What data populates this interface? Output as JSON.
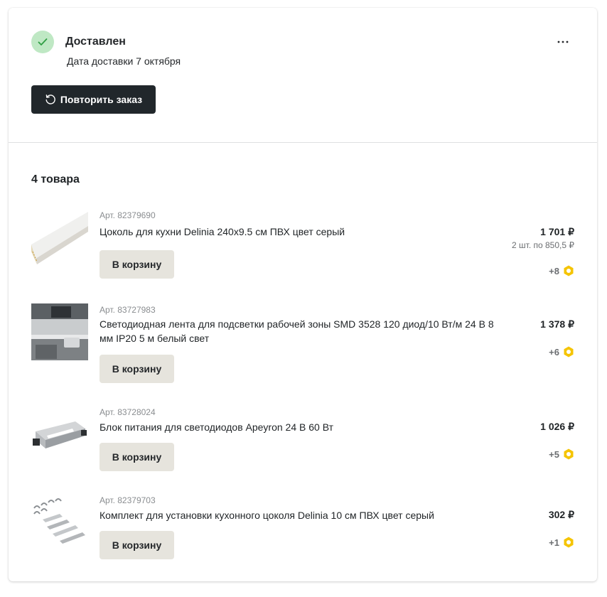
{
  "order": {
    "status_title": "Доставлен",
    "delivery_date": "Дата доставки 7 октября",
    "repeat_button": "Повторить заказ",
    "more_icon": "more-horizontal-icon",
    "items_count_title": "4 товара"
  },
  "colors": {
    "status_bg": "#bfe8c4",
    "status_check": "#2f9e44",
    "primary_button": "#21272b",
    "cart_button": "#e6e4dd",
    "bonus_badge": "#f5c400"
  },
  "items": [
    {
      "article": "Арт. 82379690",
      "name": "Цоколь для кухни Delinia 240x9.5 см ПВХ цвет серый",
      "cart_label": "В корзину",
      "price": "1 701 ₽",
      "per_unit": "2 шт. по 850,5 ₽",
      "bonus": "+8"
    },
    {
      "article": "Арт. 83727983",
      "name": "Светодиодная лента для подсветки рабочей зоны SMD 3528 120 диод/10 Вт/м 24 В 8 мм IP20 5 м белый свет",
      "cart_label": "В корзину",
      "price": "1 378 ₽",
      "per_unit": "",
      "bonus": "+6"
    },
    {
      "article": "Арт. 83728024",
      "name": "Блок питания для светодиодов Apeyron 24 В 60 Вт",
      "cart_label": "В корзину",
      "price": "1 026 ₽",
      "per_unit": "",
      "bonus": "+5"
    },
    {
      "article": "Арт. 82379703",
      "name": "Комплект для установки кухонного цоколя Delinia 10 см ПВХ цвет серый",
      "cart_label": "В корзину",
      "price": "302 ₽",
      "per_unit": "",
      "bonus": "+1"
    }
  ]
}
